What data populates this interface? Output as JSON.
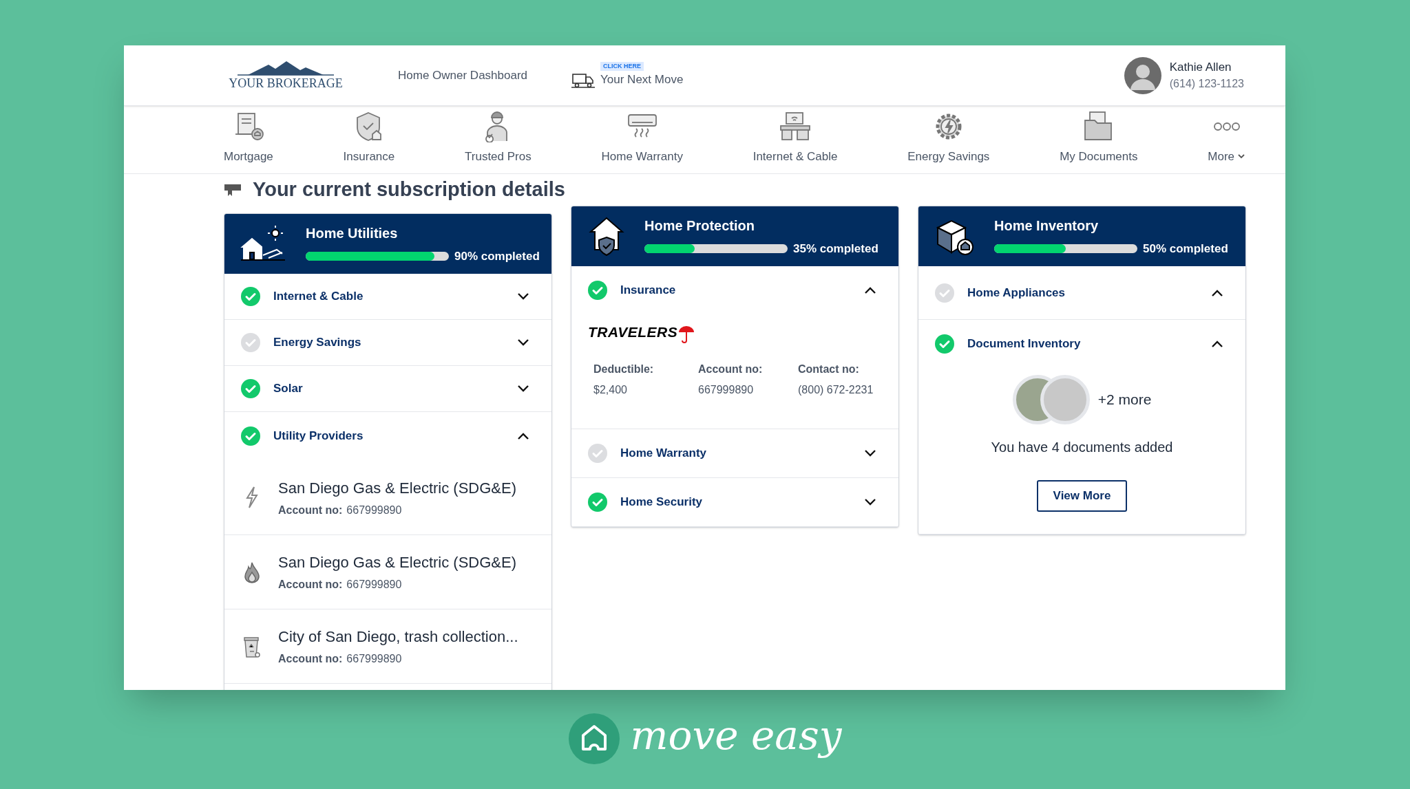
{
  "header": {
    "logo_text": "YOUR BROKERAGE",
    "dashboard_link": "Home Owner Dashboard",
    "move_badge": "CLICK HERE",
    "move_link": "Your Next Move",
    "user": {
      "name": "Kathie Allen",
      "phone": "(614) 123-1123"
    }
  },
  "nav": [
    {
      "label": "Mortgage",
      "kind": "link"
    },
    {
      "label": "Insurance",
      "kind": "link"
    },
    {
      "label": "Trusted Pros",
      "kind": "link"
    },
    {
      "label": "Home Warranty",
      "kind": "link"
    },
    {
      "label": "Internet & Cable",
      "kind": "link"
    },
    {
      "label": "Energy Savings",
      "kind": "link"
    },
    {
      "label": "My Documents",
      "kind": "link"
    },
    {
      "label": "More",
      "kind": "dropdown"
    }
  ],
  "heading": "Your current subscription details",
  "cards": [
    {
      "title": "Home Utilities",
      "progress": "90% completed",
      "level": 0.9,
      "sections": [
        {
          "kind": "plain",
          "title": "Internet & Cable",
          "done": true,
          "expanded": false
        },
        {
          "kind": "plain",
          "title": "Energy Savings",
          "done": false,
          "expanded": false
        },
        {
          "kind": "plain",
          "title": "Solar",
          "done": true,
          "expanded": false
        },
        {
          "kind": "providers",
          "title": "Utility Providers",
          "done": true,
          "expanded": true,
          "providers": [
            {
              "name": "San Diego Gas & Electric (SDG&E)",
              "account_label": "Account no:",
              "account": "667999890"
            },
            {
              "name": "San Diego Gas & Electric (SDG&E)",
              "account_label": "Account no:",
              "account": "667999890"
            },
            {
              "name": "City of San Diego, trash collection...",
              "account_label": "Account no:",
              "account": "667999890"
            }
          ]
        }
      ]
    },
    {
      "title": "Home Protection",
      "progress": "35% completed",
      "level": 0.35,
      "sections": [
        {
          "kind": "insurance",
          "title": "Insurance",
          "done": true,
          "expanded": true,
          "logo": "TRAVELERS",
          "fields": [
            {
              "label": "Deductible:",
              "value": "$2,400"
            },
            {
              "label": "Account no:",
              "value": "667999890"
            },
            {
              "label": "Contact no:",
              "value": "(800) 672-2231"
            }
          ]
        },
        {
          "kind": "plain",
          "title": "Home Warranty",
          "done": false,
          "expanded": false
        },
        {
          "kind": "plain",
          "title": "Home Security",
          "done": true,
          "expanded": false
        }
      ]
    },
    {
      "title": "Home Inventory",
      "progress": "50% completed",
      "level": 0.5,
      "sections": [
        {
          "kind": "plain",
          "title": "Home Appliances",
          "done": false,
          "expanded": true
        },
        {
          "kind": "documents",
          "title": "Document Inventory",
          "done": true,
          "expanded": true,
          "more": "+2 more",
          "summary": "You have 4 documents added",
          "button": "View More"
        }
      ]
    }
  ],
  "brand": {
    "name": "move easy"
  }
}
